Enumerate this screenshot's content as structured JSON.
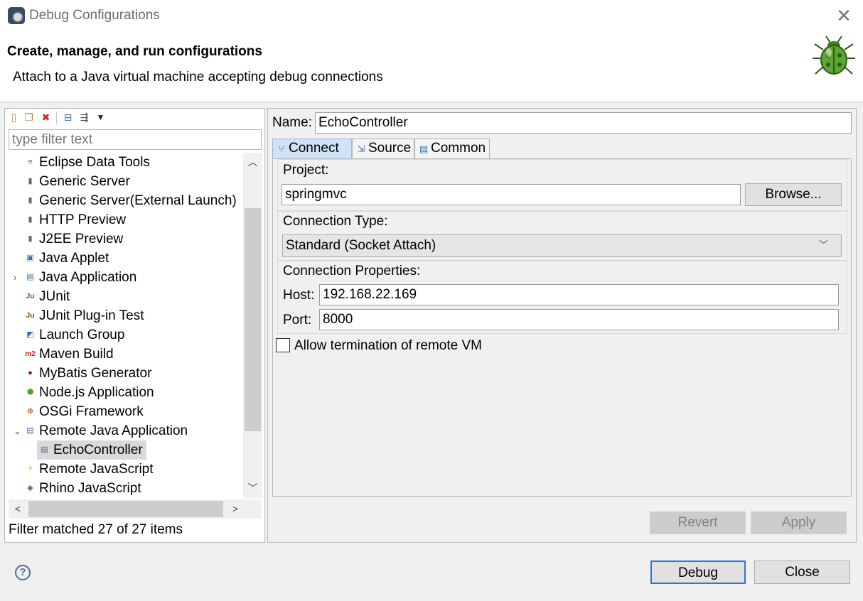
{
  "window": {
    "title": "Debug Configurations",
    "close_glyph": "✕"
  },
  "header": {
    "title": "Create, manage, and run configurations",
    "subtitle": "Attach to a Java virtual machine accepting debug connections",
    "icon": "bug-icon"
  },
  "left_panel": {
    "toolbar_icons": [
      "new-config-icon",
      "duplicate-icon",
      "delete-icon",
      "collapse-all-icon",
      "filter-icon",
      "view-menu-icon"
    ],
    "filter_placeholder": "type filter text",
    "tree": [
      {
        "label": "Eclipse Data Tools",
        "icon": "database-icon"
      },
      {
        "label": "Generic Server",
        "icon": "server-icon"
      },
      {
        "label": "Generic Server(External Launch)",
        "icon": "server-icon"
      },
      {
        "label": "HTTP Preview",
        "icon": "server-icon"
      },
      {
        "label": "J2EE Preview",
        "icon": "server-icon"
      },
      {
        "label": "Java Applet",
        "icon": "applet-icon"
      },
      {
        "label": "Java Application",
        "icon": "java-app-icon",
        "twisty": "›"
      },
      {
        "label": "JUnit",
        "icon": "junit-icon"
      },
      {
        "label": "JUnit Plug-in Test",
        "icon": "junit-plugin-icon"
      },
      {
        "label": "Launch Group",
        "icon": "launch-group-icon"
      },
      {
        "label": "Maven Build",
        "icon": "maven-icon"
      },
      {
        "label": "MyBatis Generator",
        "icon": "mybatis-icon"
      },
      {
        "label": "Node.js Application",
        "icon": "nodejs-icon"
      },
      {
        "label": "OSGi Framework",
        "icon": "osgi-icon"
      },
      {
        "label": "Remote Java Application",
        "icon": "remote-java-icon",
        "twisty": "⌄"
      },
      {
        "label": "EchoController",
        "icon": "remote-java-icon",
        "child": true,
        "selected": true
      },
      {
        "label": "Remote JavaScript",
        "icon": "remote-js-icon"
      },
      {
        "label": "Rhino JavaScript",
        "icon": "rhino-icon"
      }
    ],
    "filter_status": "Filter matched 27 of 27 items"
  },
  "config": {
    "name_label": "Name:",
    "name_value": "EchoController",
    "tabs": [
      {
        "label": "Connect",
        "icon": "connect-icon",
        "active": true
      },
      {
        "label": "Source",
        "icon": "source-icon"
      },
      {
        "label": "Common",
        "icon": "common-icon"
      }
    ],
    "project_label": "Project:",
    "project_value": "springmvc",
    "browse_label": "Browse...",
    "connection_type_label": "Connection Type:",
    "connection_type_value": "Standard (Socket Attach)",
    "connection_props_label": "Connection Properties:",
    "host_label": "Host:",
    "host_value": "192.168.22.169",
    "port_label": "Port:",
    "port_value": "8000",
    "allow_termination_label": "Allow termination of remote VM",
    "allow_termination_checked": false,
    "revert_label": "Revert",
    "apply_label": "Apply"
  },
  "footer": {
    "help_glyph": "?",
    "debug_label": "Debug",
    "close_label": "Close"
  }
}
